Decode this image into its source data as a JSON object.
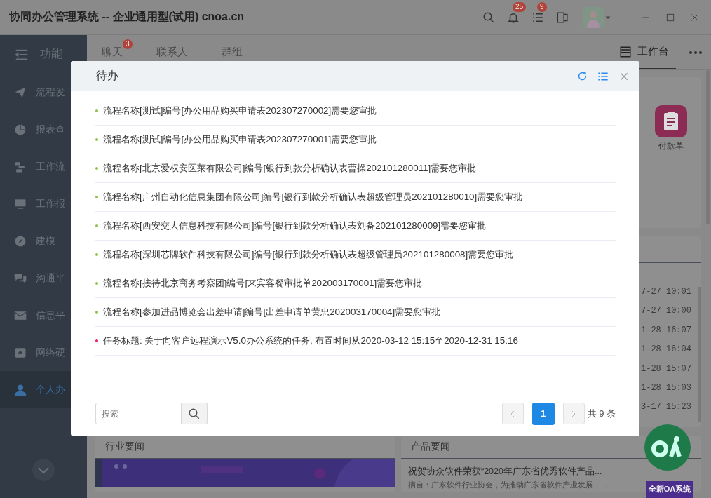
{
  "window": {
    "title": "协同办公管理系统 -- 企业通用型(试用) cnoa.cn",
    "notifications_badge": "25",
    "tasks_badge": "9"
  },
  "sidebar": {
    "header": "功能",
    "items": [
      {
        "label": "流程发",
        "selected": false
      },
      {
        "label": "报表查",
        "selected": false
      },
      {
        "label": "工作流",
        "selected": false
      },
      {
        "label": "工作报",
        "selected": false
      },
      {
        "label": "建模",
        "selected": false
      },
      {
        "label": "沟通平",
        "selected": false
      },
      {
        "label": "信息平",
        "selected": false
      },
      {
        "label": "网络硬",
        "selected": false
      },
      {
        "label": "个人办",
        "selected": true
      }
    ]
  },
  "tabs": [
    {
      "label": "聊天",
      "badge": "3",
      "selected": false
    },
    {
      "label": "联系人",
      "selected": false
    },
    {
      "label": "群组",
      "selected": false
    }
  ],
  "workbench_tab": {
    "label": "工作台",
    "selected": true
  },
  "shortcut": {
    "label": "付款单"
  },
  "recent_times": [
    "7-27 10:01",
    "7-27 10:00",
    "1-28 16:07",
    "1-28 16:04",
    "1-28 15:07",
    "1-28 15:03",
    "3-17 15:23"
  ],
  "news_cards": [
    {
      "title": "行业要闻",
      "kind": "picture"
    },
    {
      "title": "产品要闻",
      "kind": "article",
      "headline": "祝贺协众软件荣获“2020年广东省优秀软件产品...",
      "excerpt": "摘自：广东软件行业协会，为推动广东省软件产业发展，..."
    }
  ],
  "promo": {
    "text": "全新OA系统"
  },
  "dialog": {
    "title": "待办",
    "items": [
      {
        "text": "流程名称[测试]编号[办公用品购买申请表202307270002]需要您审批",
        "color": "#8bc34a"
      },
      {
        "text": "流程名称[测试]编号[办公用品购买申请表202307270001]需要您审批",
        "color": "#8bc34a"
      },
      {
        "text": "流程名称[北京爱权安医莱有限公司]编号[银行到款分析确认表曹操202101280011]需要您审批",
        "color": "#8bc34a"
      },
      {
        "text": "流程名称[广州自动化信息集团有限公司]编号[银行到款分析确认表超级管理员202101280010]需要您审批",
        "color": "#8bc34a"
      },
      {
        "text": "流程名称[西安交大信息科技有限公司]编号[银行到款分析确认表刘备202101280009]需要您审批",
        "color": "#8bc34a"
      },
      {
        "text": "流程名称[深圳芯牌软件科技有限公司]编号[银行到款分析确认表超级管理员202101280008]需要您审批",
        "color": "#8bc34a"
      },
      {
        "text": "流程名称[接待北京商务考察团]编号[来宾客餐审批单202003170001]需要您审批",
        "color": "#8bc34a"
      },
      {
        "text": "流程名称[参加进品博览会出差申请]编号[出差申请单黄忠202003170004]需要您审批",
        "color": "#8bc34a"
      },
      {
        "text": "任务标题: 关于向客户远程演示V5.0办公系统的任务, 布置时间从2020-03-12 15:15至2020-12-31 15:16",
        "color": "#e91e63"
      }
    ],
    "search": {
      "placeholder": "搜索"
    },
    "pages": [
      {
        "label": "1",
        "selected": true
      }
    ],
    "total": "共 9 条"
  }
}
